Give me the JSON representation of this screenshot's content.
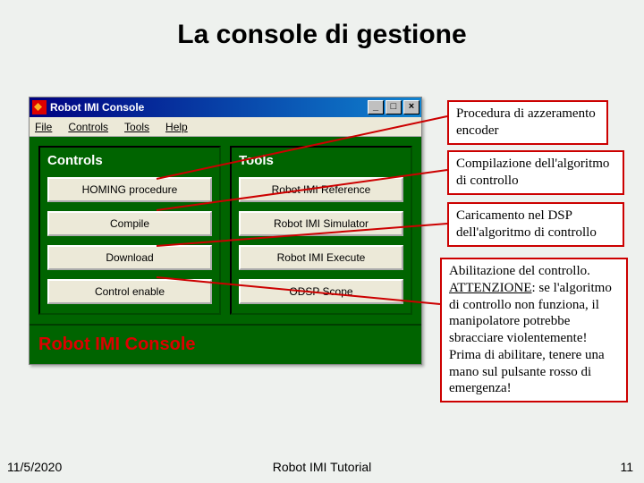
{
  "slide_title": "La console di gestione",
  "window": {
    "title": "Robot IMI Console",
    "minimize": "_",
    "maximize": "□",
    "close": "×",
    "menu": [
      "File",
      "Controls",
      "Tools",
      "Help"
    ],
    "controls_label": "Controls",
    "tools_label": "Tools",
    "controls_buttons": [
      "HOMING procedure",
      "Compile",
      "Download",
      "Control enable"
    ],
    "tools_buttons": [
      "Robot IMI Reference",
      "Robot IMI Simulator",
      "Robot IMI Execute",
      "ODSP Scope"
    ],
    "footer_label": "Robot IMI Console"
  },
  "callouts": {
    "c1": "Procedura di azzeramento encoder",
    "c2": "Compilazione dell'algoritmo di controllo",
    "c3": "Caricamento nel DSP dell'algoritmo di controllo",
    "c4_line1": "Abilitazione del controllo.",
    "c4_attention": "ATTENZIONE",
    "c4_rest": ": se l'algoritmo di controllo non funziona, il manipolatore potrebbe sbracciare violentemente! Prima di abilitare, tenere una mano sul pulsante rosso di emergenza!"
  },
  "footer": {
    "date": "11/5/2020",
    "center": "Robot IMI Tutorial",
    "page": "11"
  }
}
